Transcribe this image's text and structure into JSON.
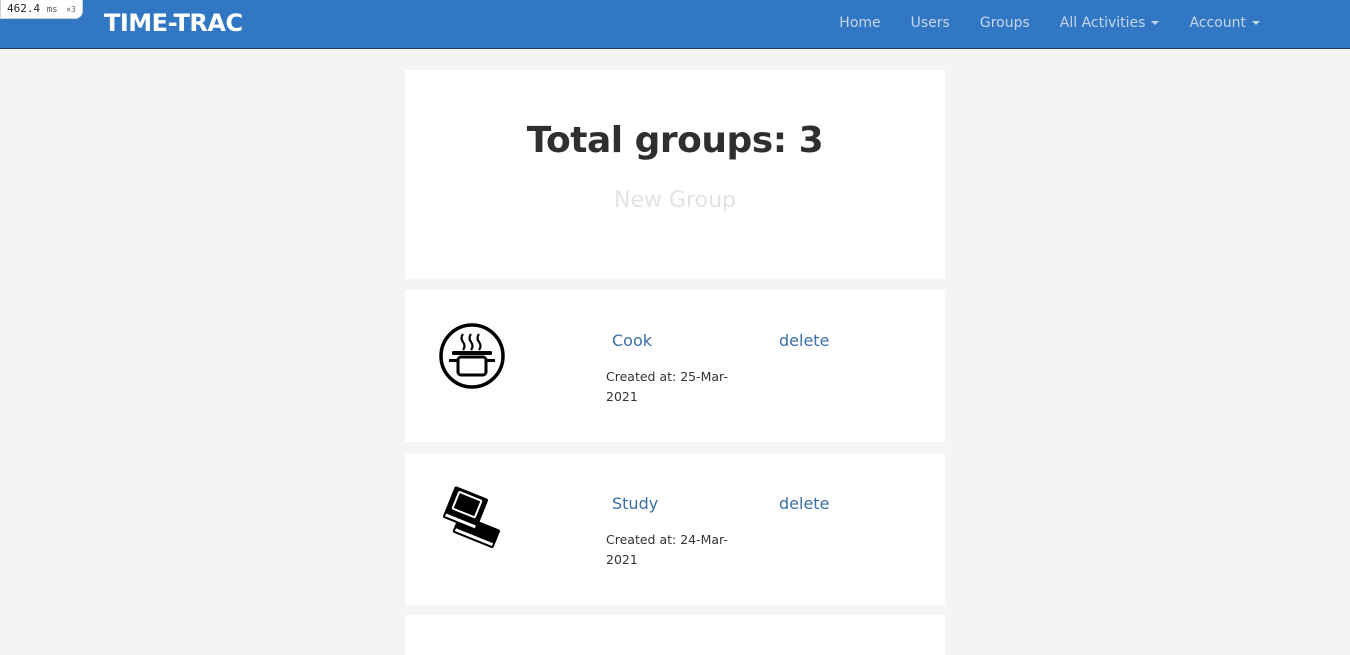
{
  "timing": {
    "value": "462.4",
    "unit": "ms",
    "multiplier": "×3"
  },
  "nav": {
    "brand": "TIME-TRAC",
    "home": "Home",
    "users": "Users",
    "groups": "Groups",
    "all_activities": "All Activities",
    "account": "Account"
  },
  "summary": {
    "title": "Total groups: 3",
    "new_group": "New Group"
  },
  "groups": [
    {
      "name": "Cook",
      "created": "Created at: 25-Mar-2021",
      "delete": "delete",
      "icon": "cooking-pot-icon"
    },
    {
      "name": "Study",
      "created": "Created at: 24-Mar-2021",
      "delete": "delete",
      "icon": "books-icon"
    }
  ],
  "colors": {
    "navbar": "#3277c3",
    "link": "#3a6fa8",
    "background": "#f4f4f4"
  }
}
